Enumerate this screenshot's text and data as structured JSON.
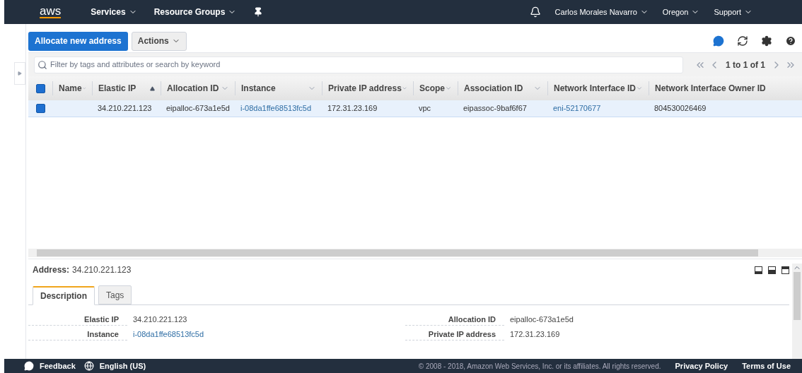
{
  "nav": {
    "logo": "aws",
    "menus": [
      {
        "label": "Services"
      },
      {
        "label": "Resource Groups"
      }
    ],
    "user_menus": [
      {
        "label": "Carlos Morales Navarro"
      },
      {
        "label": "Oregon"
      },
      {
        "label": "Support"
      }
    ]
  },
  "toolbar": {
    "primary": "Allocate new address",
    "actions": "Actions"
  },
  "filter": {
    "placeholder": "Filter by tags and attributes or search by keyword",
    "pager": "1 to 1 of 1"
  },
  "table": {
    "all_checked": true,
    "columns": [
      {
        "label": "Name",
        "kind": "menu"
      },
      {
        "label": "Elastic IP",
        "kind": "ascending"
      },
      {
        "label": "Allocation ID",
        "kind": "menu"
      },
      {
        "label": "Instance",
        "kind": "menu"
      },
      {
        "label": "Private IP address",
        "kind": "menu"
      },
      {
        "label": "Scope",
        "kind": "menu"
      },
      {
        "label": "Association ID",
        "kind": "menu"
      },
      {
        "label": "Network Interface ID",
        "kind": "menu"
      },
      {
        "label": "Network Interface Owner ID",
        "kind": "plain"
      }
    ],
    "rows": [
      {
        "selected": true,
        "checked": true,
        "cells": [
          {
            "text": "",
            "kind": "empty"
          },
          {
            "text": "34.210.221.123",
            "kind": "text"
          },
          {
            "text": "eipalloc-673a1e5d",
            "kind": "text"
          },
          {
            "text": "i-08da1ffe68513fc5d",
            "kind": "link"
          },
          {
            "text": "172.31.23.169",
            "kind": "text"
          },
          {
            "text": "vpc",
            "kind": "text"
          },
          {
            "text": "eipassoc-9baf6f67",
            "kind": "text"
          },
          {
            "text": "eni-52170677",
            "kind": "link"
          },
          {
            "text": "804530026469",
            "kind": "text"
          }
        ]
      }
    ]
  },
  "details": {
    "label": "Address:",
    "value": "34.210.221.123",
    "tabs": [
      {
        "label": "Description",
        "selected": true
      },
      {
        "label": "Tags",
        "selected": false
      }
    ],
    "left": [
      {
        "label": "Elastic IP",
        "value": "34.210.221.123",
        "kind": "text"
      },
      {
        "label": "Instance",
        "value": "i-08da1ffe68513fc5d",
        "kind": "link"
      }
    ],
    "right": [
      {
        "label": "Allocation ID",
        "value": "eipalloc-673a1e5d",
        "kind": "text"
      },
      {
        "label": "Private IP address",
        "value": "172.31.23.169",
        "kind": "text"
      }
    ]
  },
  "footer": {
    "feedback": "Feedback",
    "language": "English (US)",
    "copyright": "© 2008 - 2018, Amazon Web Services, Inc. or its affiliates. All rights reserved.",
    "links": [
      "Privacy Policy",
      "Terms of Use"
    ]
  }
}
